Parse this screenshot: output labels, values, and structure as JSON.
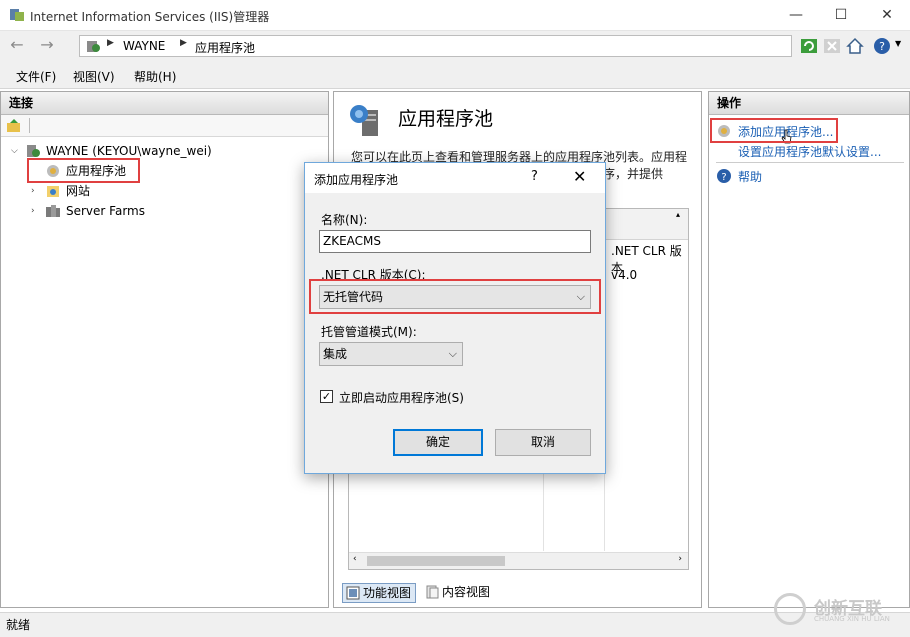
{
  "window": {
    "title": "Internet Information Services (IIS)管理器",
    "minimize": "—",
    "maximize": "☐",
    "close": "✕"
  },
  "address": {
    "crumbs": [
      "WAYNE",
      "应用程序池"
    ]
  },
  "menu": [
    "文件(F)",
    "视图(V)",
    "帮助(H)"
  ],
  "connections": {
    "header": "连接",
    "tree": [
      {
        "label": "WAYNE (KEYOU\\wayne_wei)",
        "icon": "server-icon"
      },
      {
        "label": "应用程序池",
        "icon": "app-pool-icon"
      },
      {
        "label": "网站",
        "icon": "sites-icon"
      },
      {
        "label": "Server Farms",
        "icon": "server-farms-icon"
      }
    ]
  },
  "center": {
    "title": "应用程序池",
    "description": "您可以在此页上查看和管理服务器上的应用程序池列表。应用程序池与工作进程相关联，包含一个或多个应用程序，并提供",
    "column_clr": ".NET CLR 版本",
    "cell_clr": "v4.0",
    "tabs": [
      "功能视图",
      "内容视图"
    ]
  },
  "actions": {
    "header": "操作",
    "items": [
      "添加应用程序池...",
      "设置应用程序池默认设置...",
      "帮助"
    ]
  },
  "status": "就绪",
  "dialog": {
    "title": "添加应用程序池",
    "help": "?",
    "close": "✕",
    "name_label": "名称(N):",
    "name_value": "ZKEACMS",
    "clr_label": ".NET CLR 版本(C):",
    "clr_value": "无托管代码",
    "pipeline_label": "托管管道模式(M):",
    "pipeline_value": "集成",
    "start_label": "立即启动应用程序池(S)",
    "start_checked": "✓",
    "ok": "确定",
    "cancel": "取消"
  },
  "watermark": {
    "text": "创新互联",
    "sub": "CHUANG XIN HU LIAN"
  },
  "colors": {
    "highlight": "#e04040",
    "link": "#1a5fb4",
    "accent": "#0078d7"
  }
}
